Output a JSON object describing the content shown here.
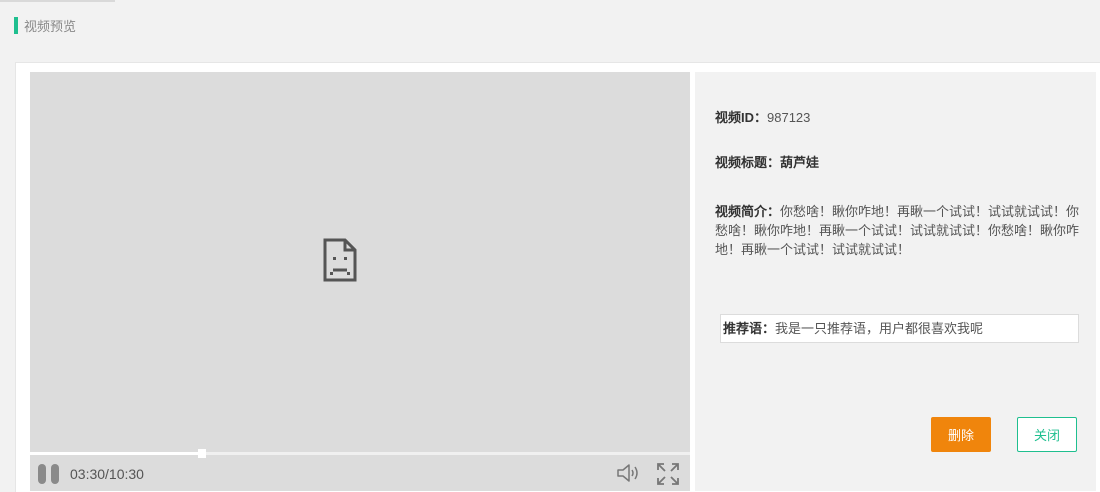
{
  "header": {
    "title": "视频预览",
    "accent_color": "#1fbf8f"
  },
  "player": {
    "placeholder_icon": "broken-file-icon",
    "progress": 0.26,
    "current_time": "03:30",
    "separator": "/",
    "total_time": "10:30",
    "time_display": "03:30/10:30",
    "pause_icon": "pause-icon",
    "volume_icon": "volume-icon",
    "fullscreen_icon": "fullscreen-icon"
  },
  "info": {
    "id_label": "视频ID：",
    "id_value": "987123",
    "title_label": "视频标题：",
    "title_value": "葫芦娃",
    "desc_label": "视频简介：",
    "desc_value": "你愁啥！瞅你咋地！再瞅一个试试！试试就试试！你愁啥！瞅你咋地！再瞅一个试试！试试就试试！你愁啥！瞅你咋地！再瞅一个试试！试试就试试！",
    "recommend_label": "推荐语：",
    "recommend_value": "我是一只推荐语，用户都很喜欢我呢"
  },
  "actions": {
    "delete_label": "删除",
    "close_label": "关闭",
    "delete_color": "#f0850c",
    "close_color": "#1fbf8f"
  }
}
